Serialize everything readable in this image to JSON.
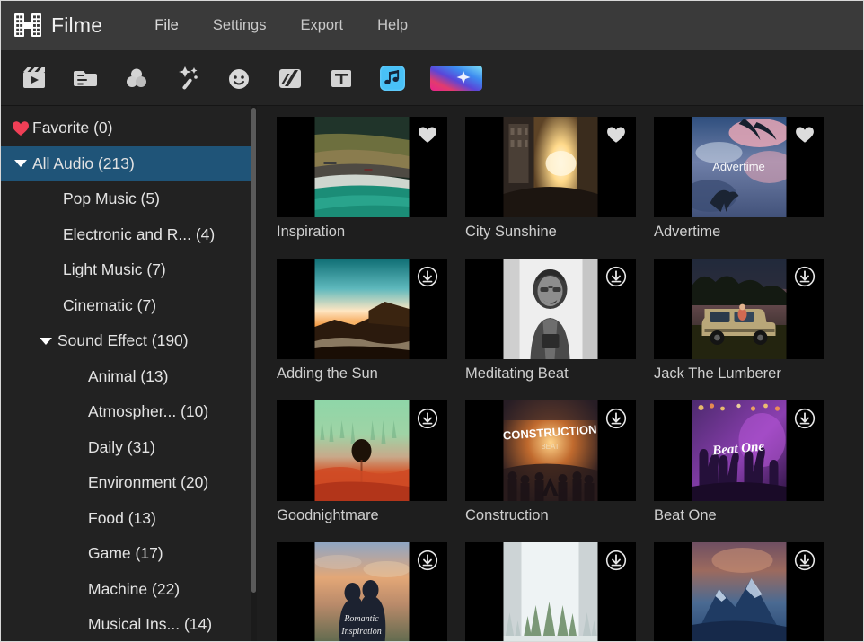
{
  "app": {
    "brand": "Filme",
    "logo_icon": "film-strip-icon",
    "accent_selected": "#1f5478",
    "accent_active_tool": "#54c8f8",
    "heart_color": "#ef3f56"
  },
  "menu": {
    "items": [
      {
        "label": "File",
        "name": "menu-file"
      },
      {
        "label": "Settings",
        "name": "menu-settings"
      },
      {
        "label": "Export",
        "name": "menu-export"
      },
      {
        "label": "Help",
        "name": "menu-help"
      }
    ]
  },
  "toolbar": {
    "items": [
      {
        "icon": "media-clapperboard-icon",
        "name": "tool-media",
        "active": false
      },
      {
        "icon": "document-folder-icon",
        "name": "tool-project",
        "active": false
      },
      {
        "icon": "color-circles-icon",
        "name": "tool-filters",
        "active": false
      },
      {
        "icon": "magic-wand-effects-icon",
        "name": "tool-effects",
        "active": false
      },
      {
        "icon": "smiley-sticker-icon",
        "name": "tool-stickers",
        "active": false
      },
      {
        "icon": "transitions-icon",
        "name": "tool-transitions",
        "active": false
      },
      {
        "icon": "text-t-icon",
        "name": "tool-text",
        "active": false
      },
      {
        "icon": "music-note-icon",
        "name": "tool-audio",
        "active": true
      },
      {
        "icon": "gradient-sparkle-icon",
        "name": "tool-overlays",
        "active": false
      }
    ]
  },
  "sidebar": {
    "items": [
      {
        "label": "Favorite (0)",
        "name": "sidebar-item-favorite",
        "indent": 0,
        "icon": "heart-icon",
        "expander": "none",
        "selected": false
      },
      {
        "label": "All Audio (213)",
        "name": "sidebar-item-all-audio",
        "indent": 0,
        "icon": "none",
        "expander": "down",
        "selected": true
      },
      {
        "label": "Pop Music (5)",
        "name": "sidebar-item-pop-music",
        "indent": 2,
        "icon": "none",
        "expander": "none",
        "selected": false
      },
      {
        "label": "Electronic and R... (4)",
        "name": "sidebar-item-electronic-and-r",
        "indent": 2,
        "icon": "none",
        "expander": "none",
        "selected": false
      },
      {
        "label": "Light Music (7)",
        "name": "sidebar-item-light-music",
        "indent": 2,
        "icon": "none",
        "expander": "none",
        "selected": false
      },
      {
        "label": "Cinematic (7)",
        "name": "sidebar-item-cinematic",
        "indent": 2,
        "icon": "none",
        "expander": "none",
        "selected": false
      },
      {
        "label": "Sound Effect (190)",
        "name": "sidebar-item-sound-effect",
        "indent": 1,
        "icon": "none",
        "expander": "down",
        "selected": false
      },
      {
        "label": "Animal (13)",
        "name": "sidebar-item-animal",
        "indent": 3,
        "icon": "none",
        "expander": "none",
        "selected": false
      },
      {
        "label": "Atmospher... (10)",
        "name": "sidebar-item-atmosphere",
        "indent": 3,
        "icon": "none",
        "expander": "none",
        "selected": false
      },
      {
        "label": "Daily (31)",
        "name": "sidebar-item-daily",
        "indent": 3,
        "icon": "none",
        "expander": "none",
        "selected": false
      },
      {
        "label": "Environment (20)",
        "name": "sidebar-item-environment",
        "indent": 3,
        "icon": "none",
        "expander": "none",
        "selected": false
      },
      {
        "label": "Food (13)",
        "name": "sidebar-item-food",
        "indent": 3,
        "icon": "none",
        "expander": "none",
        "selected": false
      },
      {
        "label": "Game (17)",
        "name": "sidebar-item-game",
        "indent": 3,
        "icon": "none",
        "expander": "none",
        "selected": false
      },
      {
        "label": "Machine (22)",
        "name": "sidebar-item-machine",
        "indent": 3,
        "icon": "none",
        "expander": "none",
        "selected": false
      },
      {
        "label": "Musical Ins... (14)",
        "name": "sidebar-item-musical-instrument",
        "indent": 3,
        "icon": "none",
        "expander": "none",
        "selected": false
      }
    ]
  },
  "library": {
    "cards": [
      {
        "title": "Inspiration",
        "badge": "heart-icon",
        "art": "coastal-road-aerial"
      },
      {
        "title": "City Sunshine",
        "badge": "heart-icon",
        "art": "city-street-sunset"
      },
      {
        "title": "Advertime",
        "badge": "heart-icon",
        "art": "pink-clouds-palms"
      },
      {
        "title": "Adding the Sun",
        "badge": "download-icon",
        "art": "sunrise-over-hills"
      },
      {
        "title": "Meditating Beat",
        "badge": "download-icon",
        "art": "bw-portrait-man"
      },
      {
        "title": "Jack The Lumberer",
        "badge": "download-icon",
        "art": "pickup-truck-field"
      },
      {
        "title": "Goodnightmare",
        "badge": "download-icon",
        "art": "green-red-balloon"
      },
      {
        "title": "Construction",
        "badge": "download-icon",
        "art": "concert-construction"
      },
      {
        "title": "Beat One",
        "badge": "download-icon",
        "art": "purple-crowd-hands"
      },
      {
        "title": "",
        "badge": "download-icon",
        "art": "romantic-couple-sunset"
      },
      {
        "title": "",
        "badge": "download-icon",
        "art": "snowy-forest"
      },
      {
        "title": "",
        "badge": "download-icon",
        "art": "blue-mountain-peak"
      }
    ]
  }
}
